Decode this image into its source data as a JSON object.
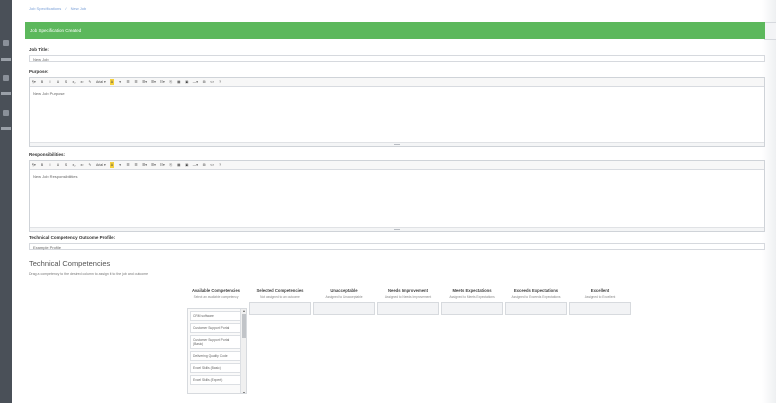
{
  "breadcrumb": [
    "Job Specifications",
    "New Job"
  ],
  "banner": {
    "text": "Job Specification Created"
  },
  "job_title": {
    "label": "Job Title:",
    "value": "New Job"
  },
  "purpose": {
    "label": "Purpose:",
    "body": "New Job Purpose"
  },
  "responsibilities": {
    "label": "Responsibilities:",
    "body": "New Job Responsibilities"
  },
  "toolbar": {
    "buttons": [
      "¶▾",
      "B",
      "I",
      "U",
      "S",
      "x₂",
      "x²",
      "✎",
      "Arial ▾",
      "A",
      "▾",
      "☰",
      "☰",
      "☰▾",
      "☰▾",
      "☷▾",
      "⎘",
      "▦",
      "▣",
      "—▾",
      "⊞",
      "<>",
      "?"
    ]
  },
  "profile": {
    "label": "Technical Competency Outcome Profile:",
    "value": "Example Profile"
  },
  "competencies": {
    "title": "Technical Competencies",
    "help": "Drag a competency to the desired column to assign it to the job and outcome",
    "columns": [
      {
        "header": "Available Competencies",
        "sub": "Select an available competency"
      },
      {
        "header": "Selected Competencies",
        "sub": "Not assigned to an outcome"
      },
      {
        "header": "Unacceptable",
        "sub": "Assigned to Unacceptable"
      },
      {
        "header": "Needs Improvement",
        "sub": "Assigned to Needs Improvement"
      },
      {
        "header": "Meets Expectations",
        "sub": "Assigned to Meets Expectations"
      },
      {
        "header": "Exceeds Expectations",
        "sub": "Assigned to Exceeds Expectations"
      },
      {
        "header": "Excellent",
        "sub": "Assigned to Excellent"
      }
    ],
    "available": [
      "CRM software",
      "Customer Support Portal",
      "Customer Support Portal (Basic)",
      "Delivering Quality Code",
      "Excel Skills (Basic)",
      "Excel Skills (Expert)"
    ]
  }
}
